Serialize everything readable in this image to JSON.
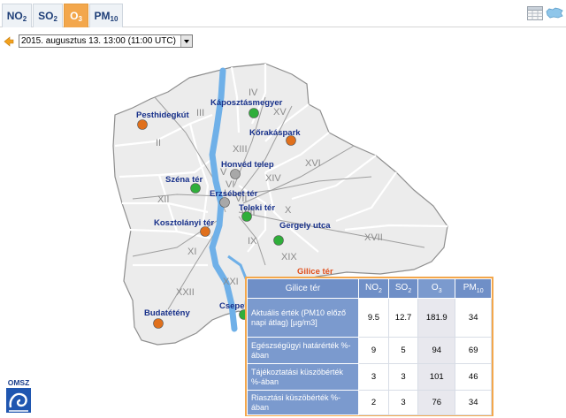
{
  "tabs": [
    {
      "base": "NO",
      "sub": "2"
    },
    {
      "base": "SO",
      "sub": "2"
    },
    {
      "base": "O",
      "sub": "3"
    },
    {
      "base": "PM",
      "sub": "10"
    }
  ],
  "active_tab": "O3",
  "date_selector": {
    "value": "2015. augusztus 13. 13:00 (11:00  UTC)"
  },
  "districts": [
    "I",
    "II",
    "III",
    "IV",
    "V",
    "VI",
    "VII",
    "VIII",
    "IX",
    "X",
    "XI",
    "XII",
    "XIII",
    "XIV",
    "XV",
    "XVI",
    "XVII",
    "XIX",
    "XXI",
    "XXII"
  ],
  "stations": [
    {
      "name": "Pesthidegkút",
      "status": "orange"
    },
    {
      "name": "Káposztásmegyer",
      "status": "green"
    },
    {
      "name": "Kőrakáspark",
      "status": "orange"
    },
    {
      "name": "Honvéd telep",
      "status": "gray"
    },
    {
      "name": "Széna tér",
      "status": "green"
    },
    {
      "name": "Erzsébet tér",
      "status": "gray"
    },
    {
      "name": "Teleki tér",
      "status": "green"
    },
    {
      "name": "Kosztolányi tér",
      "status": "orange"
    },
    {
      "name": "Gergely utca",
      "status": "green"
    },
    {
      "name": "Gilice tér",
      "status": "orange"
    },
    {
      "name": "Csepel",
      "status": "green"
    },
    {
      "name": "Budatétény",
      "status": "orange"
    }
  ],
  "status_colors": {
    "green": "#2fae3a",
    "orange": "#e0701c",
    "gray": "#a8a8a8"
  },
  "popup": {
    "station": "Gilice tér",
    "columns": [
      {
        "base": "NO",
        "sub": "2"
      },
      {
        "base": "SO",
        "sub": "2"
      },
      {
        "base": "O",
        "sub": "3"
      },
      {
        "base": "PM",
        "sub": "10"
      }
    ],
    "rows": [
      {
        "label": "Aktuális érték (PM10 előző napi átlag) [µg/m3]",
        "values": [
          "9.5",
          "12.7",
          "181.9",
          "34"
        ]
      },
      {
        "label": "Egészségügyi határérték %-ában",
        "values": [
          "9",
          "5",
          "94",
          "69"
        ]
      },
      {
        "label": "Tájékoztatási küszöbérték %-ában",
        "values": [
          "3",
          "3",
          "101",
          "46"
        ]
      },
      {
        "label": "Riasztási küszöbérték %-ában",
        "values": [
          "2",
          "3",
          "76",
          "34"
        ]
      }
    ]
  },
  "logo_text": "OMSZ"
}
